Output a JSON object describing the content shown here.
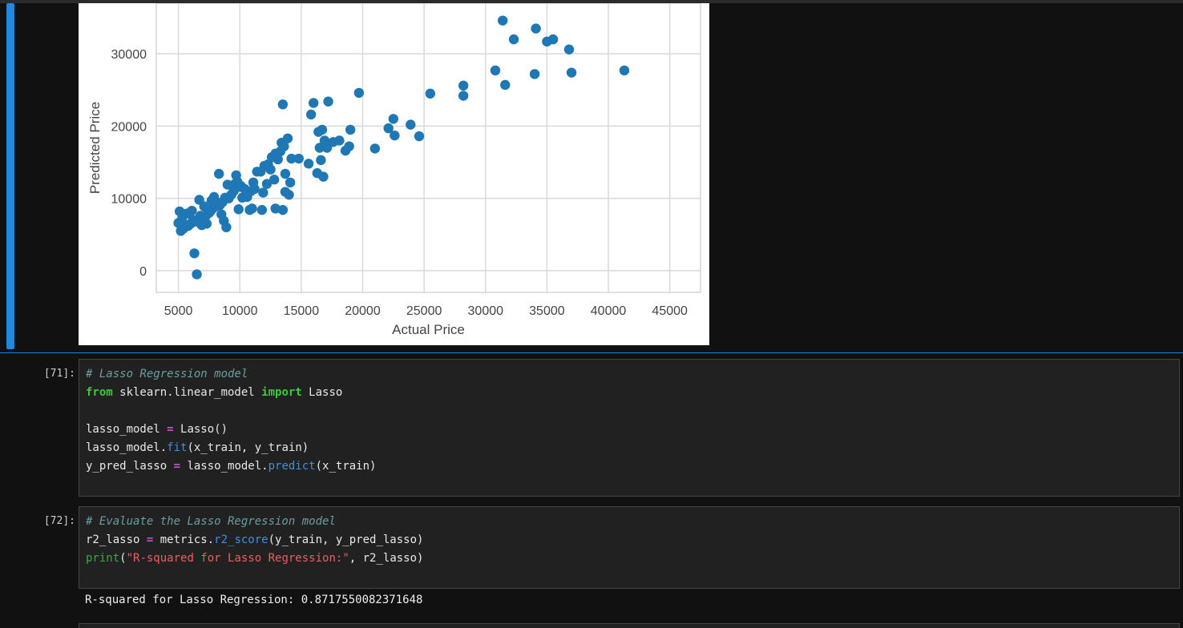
{
  "chart_data": {
    "type": "scatter",
    "xlabel": "Actual Price",
    "ylabel": "Predicted Price",
    "xlim": [
      3200,
      47500
    ],
    "ylim": [
      -3000,
      37000
    ],
    "xticks": [
      5000,
      10000,
      15000,
      20000,
      25000,
      30000,
      35000,
      40000,
      45000
    ],
    "yticks": [
      0,
      10000,
      20000,
      30000
    ],
    "grid": true,
    "color": "#1f77b4",
    "x": [
      31400,
      34100,
      32300,
      35000,
      35500,
      36800,
      30800,
      31600,
      34000,
      37000,
      41300,
      28200,
      28200,
      25500,
      19700,
      13500,
      16000,
      17200,
      15800,
      22500,
      22100,
      23900,
      22600,
      24600,
      21000,
      19000,
      18100,
      18600,
      18900,
      17100,
      16700,
      16400,
      16500,
      16900,
      17600,
      16600,
      16300,
      16800,
      15600,
      14800,
      14200,
      13900,
      13600,
      13400,
      13100,
      12900,
      12600,
      12300,
      12000,
      11700,
      11400,
      11100,
      10900,
      10700,
      10400,
      10100,
      9800,
      9500,
      9300,
      9100,
      8800,
      8600,
      8400,
      8200,
      8000,
      7800,
      7600,
      7400,
      7200,
      7000,
      6800,
      6600,
      6400,
      6200,
      6000,
      5800,
      5600,
      5400,
      5200,
      5100,
      5000,
      6500,
      6300,
      7100,
      7700,
      8300,
      9700,
      10200,
      11200,
      11900,
      12800,
      13700,
      14100,
      13500,
      13700,
      14000,
      12900,
      10800,
      11000,
      11800,
      9900,
      8900,
      8700,
      8500,
      7500,
      7300,
      6900,
      6700,
      7900,
      8100,
      9000,
      9600,
      10000,
      10600,
      12200,
      12500,
      13300,
      5300,
      5700,
      6100
    ],
    "y": [
      34600,
      33500,
      32000,
      31700,
      32000,
      30600,
      27700,
      25700,
      27200,
      27400,
      27700,
      25600,
      24200,
      24500,
      24600,
      23000,
      23200,
      23400,
      21600,
      21000,
      19700,
      20200,
      18700,
      18600,
      16900,
      19500,
      18000,
      16600,
      17200,
      17000,
      19500,
      19200,
      17000,
      18000,
      17800,
      15300,
      13500,
      13000,
      14800,
      15500,
      15500,
      18300,
      17200,
      17700,
      15400,
      16200,
      15700,
      14700,
      14500,
      13700,
      13700,
      12200,
      11000,
      10800,
      11300,
      11700,
      12300,
      11000,
      10500,
      10000,
      10100,
      9500,
      9100,
      9400,
      8900,
      8600,
      8200,
      7900,
      7500,
      7300,
      7600,
      7100,
      6800,
      7000,
      6500,
      6200,
      6100,
      5800,
      5500,
      8200,
      6600,
      -500,
      2400,
      8900,
      9700,
      13400,
      13200,
      10100,
      11300,
      10800,
      12600,
      13400,
      12200,
      8400,
      10900,
      10500,
      8600,
      8400,
      8600,
      8400,
      8500,
      6000,
      6900,
      7800,
      8000,
      6500,
      6300,
      9800,
      10200,
      9000,
      11900,
      12000,
      11600,
      10200,
      12000,
      14000,
      16500,
      7200,
      7900,
      8300
    ]
  },
  "cells": [
    {
      "prompt": "[71]:",
      "lines": [
        [
          {
            "t": "comment",
            "v": "# Lasso Regression model"
          }
        ],
        [
          {
            "t": "kw",
            "v": "from"
          },
          {
            "t": "plain",
            "v": " sklearn.linear_model "
          },
          {
            "t": "kw",
            "v": "import"
          },
          {
            "t": "plain",
            "v": " Lasso"
          }
        ],
        [],
        [
          {
            "t": "plain",
            "v": "lasso_model "
          },
          {
            "t": "op",
            "v": "="
          },
          {
            "t": "plain",
            "v": " Lasso()"
          }
        ],
        [
          {
            "t": "plain",
            "v": "lasso_model."
          },
          {
            "t": "fn",
            "v": "fit"
          },
          {
            "t": "plain",
            "v": "(x_train, y_train)"
          }
        ],
        [
          {
            "t": "plain",
            "v": "y_pred_lasso "
          },
          {
            "t": "op",
            "v": "="
          },
          {
            "t": "plain",
            "v": " lasso_model."
          },
          {
            "t": "fn",
            "v": "predict"
          },
          {
            "t": "plain",
            "v": "(x_train)"
          }
        ]
      ]
    },
    {
      "prompt": "[72]:",
      "lines": [
        [
          {
            "t": "comment",
            "v": "# Evaluate the Lasso Regression model"
          }
        ],
        [
          {
            "t": "plain",
            "v": "r2_lasso "
          },
          {
            "t": "op",
            "v": "="
          },
          {
            "t": "plain",
            "v": " metrics."
          },
          {
            "t": "fn",
            "v": "r2_score"
          },
          {
            "t": "plain",
            "v": "(y_train, y_pred_lasso)"
          }
        ],
        [
          {
            "t": "builtin",
            "v": "print"
          },
          {
            "t": "plain",
            "v": "("
          },
          {
            "t": "str",
            "v": "\"R-squared for Lasso Regression:\""
          },
          {
            "t": "plain",
            "v": ", r2_lasso)"
          }
        ]
      ]
    }
  ],
  "output": {
    "text": "R-squared for Lasso Regression: 0.8717550082371648"
  }
}
